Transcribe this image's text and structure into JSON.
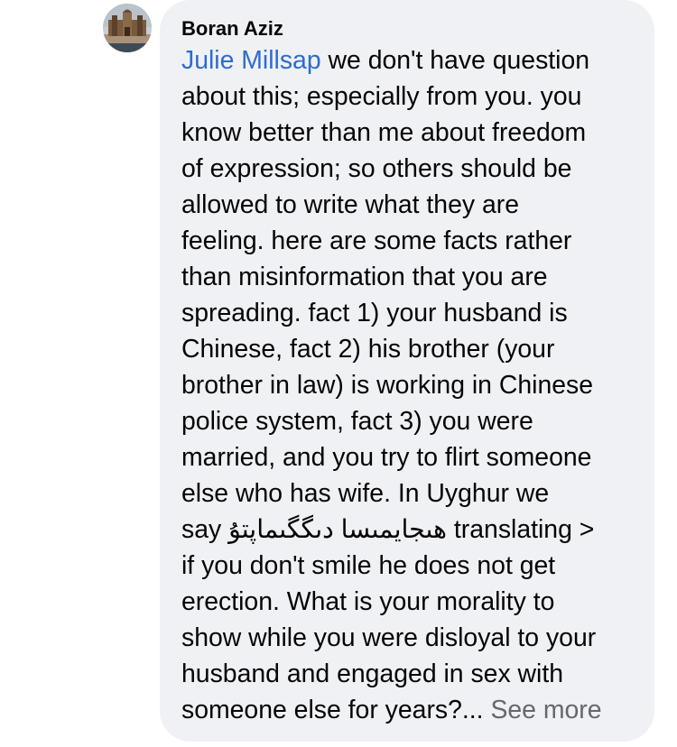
{
  "comment": {
    "author": "Boran Aziz",
    "mention": "Julie Millsap",
    "lines": [
      " we don't have question",
      "about this; especially from you.  you",
      "know better than me about freedom",
      "of expression; so others should be",
      "allowed to write what they are",
      "feeling. here are some facts rather",
      "than misinformation that you are",
      "spreading.   fact 1) your husband is",
      "Chinese, fact 2) his brother (your",
      "brother in law) is working in Chinese",
      "police system, fact 3) you were",
      "married, and you try to flirt someone",
      "else who has wife.   In Uyghur we"
    ],
    "say_prefix": "say ",
    "uyghur_phrase": "ھىجايمىسا دىگگىماپتۇ",
    "say_suffix": " translating >",
    "lines_after": [
      "if you don't smile he does not get",
      "erection.  What is your morality to",
      "show while you were disloyal to your",
      "husband and engaged in sex with"
    ],
    "last_line": "someone else for years?...",
    "see_more_label": "See more"
  },
  "avatar": {
    "icon": "profile-photo-icon"
  },
  "colors": {
    "bubble_bg": "#f0f1f4",
    "mention": "#2d6ccf",
    "see_more": "#65676b",
    "text": "#050505"
  }
}
